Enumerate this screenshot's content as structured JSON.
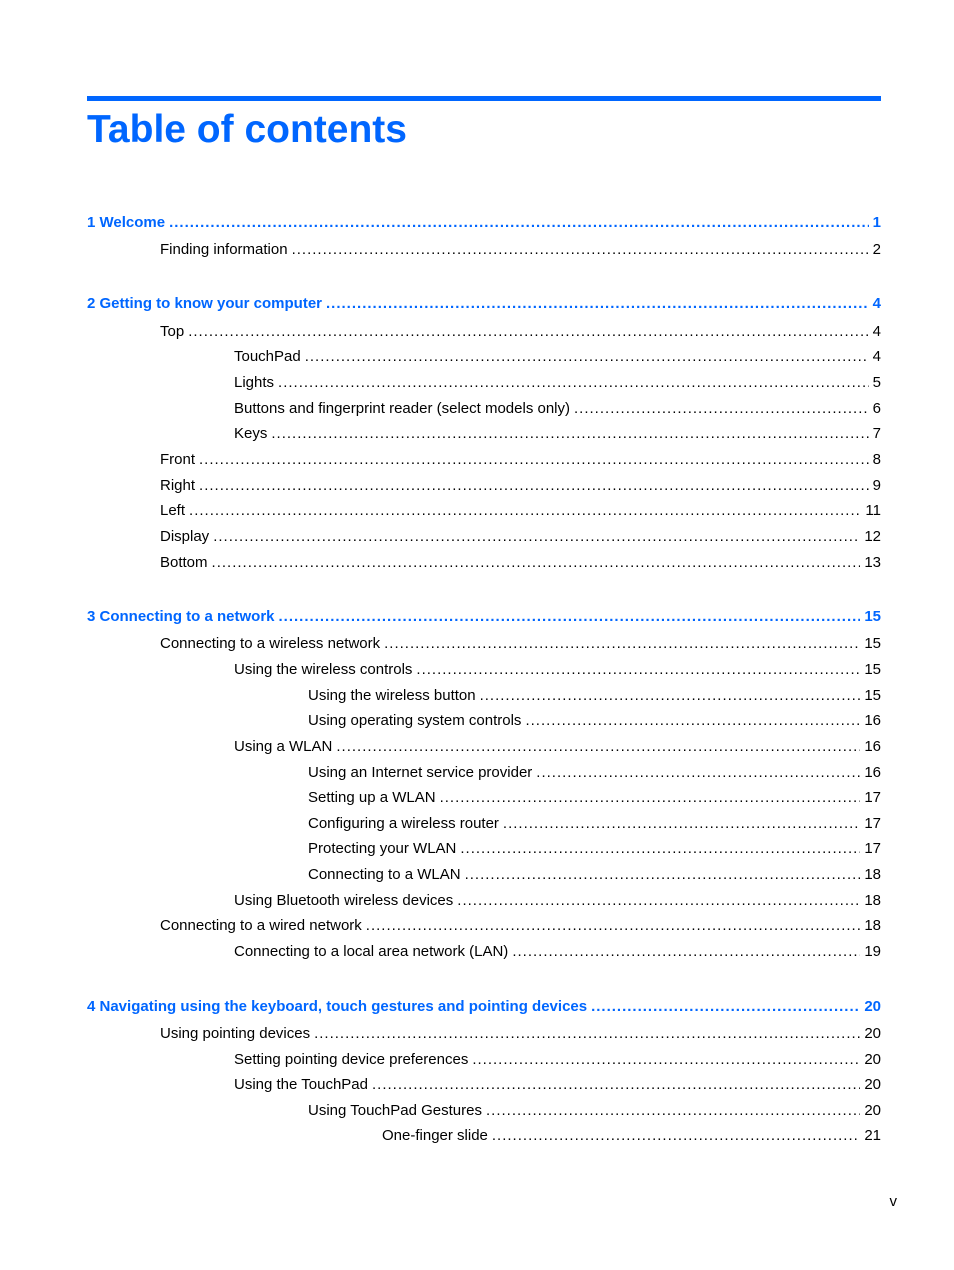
{
  "document": {
    "title": "Table of contents",
    "page_number": "v",
    "accent_color": "#0066ff"
  },
  "toc": [
    {
      "level": 1,
      "label": "1  Welcome",
      "page": "1",
      "top": 0
    },
    {
      "level": 2,
      "label": "Finding information",
      "page": "2"
    },
    {
      "level": 1,
      "label": "2  Getting to know your computer",
      "page": "4"
    },
    {
      "level": 2,
      "label": "Top",
      "page": "4"
    },
    {
      "level": 3,
      "label": "TouchPad",
      "page": "4"
    },
    {
      "level": 3,
      "label": "Lights",
      "page": "5"
    },
    {
      "level": 3,
      "label": "Buttons and fingerprint reader (select models only)",
      "page": "6"
    },
    {
      "level": 3,
      "label": "Keys",
      "page": "7"
    },
    {
      "level": 2,
      "label": "Front",
      "page": "8"
    },
    {
      "level": 2,
      "label": "Right",
      "page": "9"
    },
    {
      "level": 2,
      "label": "Left",
      "page": "11"
    },
    {
      "level": 2,
      "label": "Display",
      "page": "12"
    },
    {
      "level": 2,
      "label": "Bottom",
      "page": "13"
    },
    {
      "level": 1,
      "label": "3  Connecting to a network",
      "page": "15"
    },
    {
      "level": 2,
      "label": "Connecting to a wireless network",
      "page": "15"
    },
    {
      "level": 3,
      "label": "Using the wireless controls",
      "page": "15"
    },
    {
      "level": 4,
      "label": "Using the wireless button",
      "page": "15"
    },
    {
      "level": 4,
      "label": "Using operating system controls",
      "page": "16"
    },
    {
      "level": 3,
      "label": "Using a WLAN",
      "page": "16"
    },
    {
      "level": 4,
      "label": "Using an Internet service provider",
      "page": "16"
    },
    {
      "level": 4,
      "label": "Setting up a WLAN",
      "page": "17"
    },
    {
      "level": 4,
      "label": "Configuring a wireless router",
      "page": "17"
    },
    {
      "level": 4,
      "label": "Protecting your WLAN",
      "page": "17"
    },
    {
      "level": 4,
      "label": "Connecting to a WLAN",
      "page": "18"
    },
    {
      "level": 3,
      "label": "Using Bluetooth wireless devices",
      "page": "18"
    },
    {
      "level": 2,
      "label": "Connecting to a wired network",
      "page": "18"
    },
    {
      "level": 3,
      "label": "Connecting to a local area network (LAN)",
      "page": "19"
    },
    {
      "level": 1,
      "label": "4  Navigating using the keyboard, touch gestures and pointing devices",
      "page": "20"
    },
    {
      "level": 2,
      "label": "Using pointing devices",
      "page": "20"
    },
    {
      "level": 3,
      "label": "Setting pointing device preferences",
      "page": "20"
    },
    {
      "level": 3,
      "label": "Using the TouchPad",
      "page": "20"
    },
    {
      "level": 4,
      "label": "Using TouchPad Gestures",
      "page": "20"
    },
    {
      "level": 5,
      "label": "One-finger slide",
      "page": "21"
    }
  ]
}
